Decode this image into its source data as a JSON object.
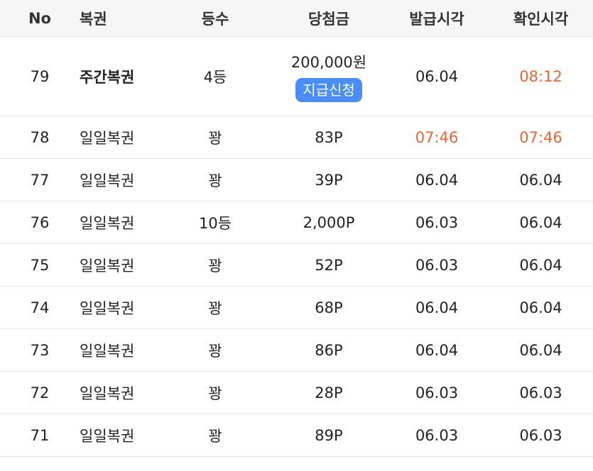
{
  "header": {
    "no": "No",
    "type": "복권",
    "rank": "등수",
    "prize": "당첨금",
    "issued": "발급시각",
    "checked": "확인시각"
  },
  "claim_button_label": "지급신청",
  "accent_colors": {
    "highlight_time": "#e0683a",
    "claim_button": "#4a8ef5"
  },
  "rows": [
    {
      "no": "79",
      "type": "주간복권",
      "rank": "4등",
      "prize": "200,000원",
      "issued": "06.04",
      "checked": "08:12"
    },
    {
      "no": "78",
      "type": "일일복권",
      "rank": "꽝",
      "prize": "83P",
      "issued": "07:46",
      "checked": "07:46"
    },
    {
      "no": "77",
      "type": "일일복권",
      "rank": "꽝",
      "prize": "39P",
      "issued": "06.04",
      "checked": "06.04"
    },
    {
      "no": "76",
      "type": "일일복권",
      "rank": "10등",
      "prize": "2,000P",
      "issued": "06.03",
      "checked": "06.04"
    },
    {
      "no": "75",
      "type": "일일복권",
      "rank": "꽝",
      "prize": "52P",
      "issued": "06.03",
      "checked": "06.04"
    },
    {
      "no": "74",
      "type": "일일복권",
      "rank": "꽝",
      "prize": "68P",
      "issued": "06.04",
      "checked": "06.04"
    },
    {
      "no": "73",
      "type": "일일복권",
      "rank": "꽝",
      "prize": "86P",
      "issued": "06.04",
      "checked": "06.04"
    },
    {
      "no": "72",
      "type": "일일복권",
      "rank": "꽝",
      "prize": "28P",
      "issued": "06.03",
      "checked": "06.03"
    },
    {
      "no": "71",
      "type": "일일복권",
      "rank": "꽝",
      "prize": "89P",
      "issued": "06.03",
      "checked": "06.03"
    }
  ]
}
